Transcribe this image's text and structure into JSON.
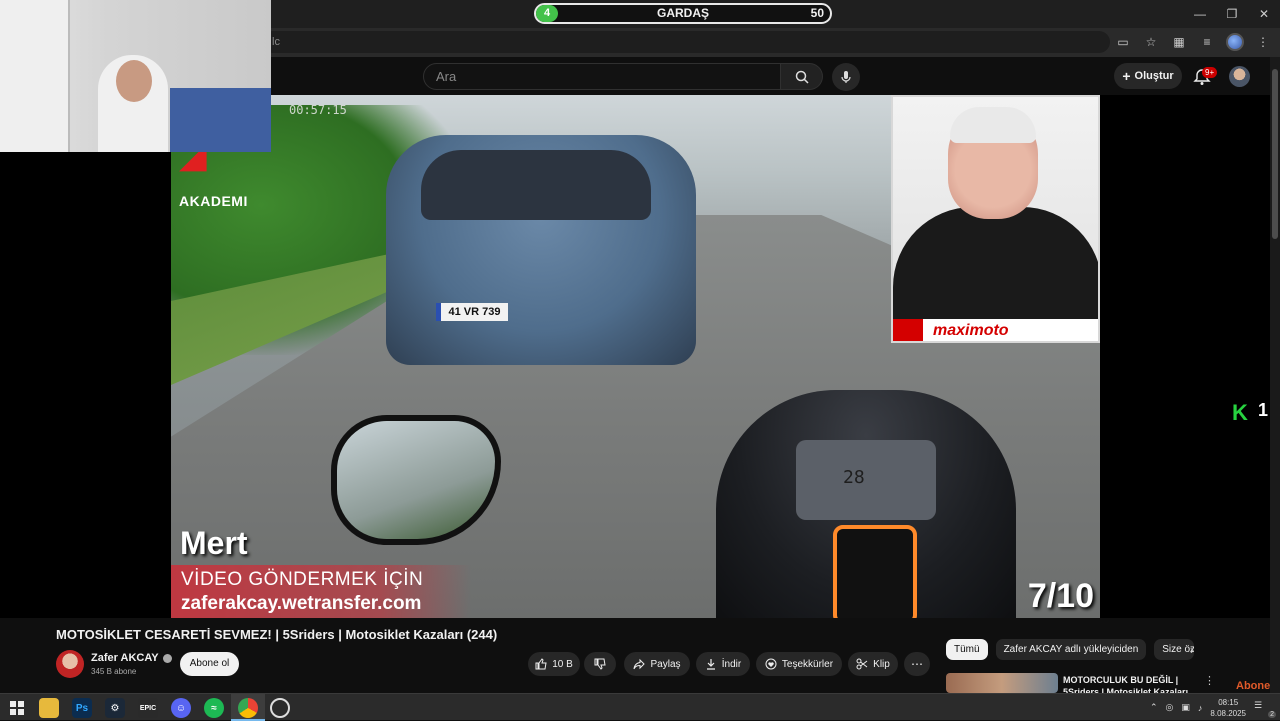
{
  "poll": {
    "left_value": "4",
    "title": "GARDAŞ",
    "right_value": "50"
  },
  "omnibox": {
    "text": "lc"
  },
  "youtube": {
    "search_placeholder": "Ara",
    "create_label": "Oluştur",
    "notifications_badge": "9+"
  },
  "video": {
    "timestamp": "00:57:15",
    "brand_text": "AKADEMI",
    "plate": "41 VR 739",
    "speed": "28",
    "sender_name": "Mert",
    "send_line1": "VİDEO GÖNDERMEK İÇİN",
    "send_line2": "zaferakcay.wetransfer.com",
    "counter": "7/10",
    "pip_brand": "maximoto"
  },
  "overlay": {
    "k_number": "1",
    "abone": "Abone ol"
  },
  "meta": {
    "title": "MOTOSİKLET CESARETİ SEVMEZ! | 5Sriders | Motosiklet Kazaları (244)",
    "channel_name": "Zafer AKCAY",
    "subscribers": "345 B abone",
    "subscribe_label": "Abone ol",
    "like_count": "10 B",
    "share_label": "Paylaş",
    "download_label": "İndir",
    "thanks_label": "Teşekkürler",
    "clip_label": "Klip"
  },
  "chips": [
    "Tümü",
    "Zafer AKCAY adlı yükleyiciden",
    "Size özel"
  ],
  "recommendation": {
    "title": "MOTORCULUK BU DEĞİL | 5Sriders | Motosiklet Kazaları"
  },
  "taskbar": {
    "time": "08:15",
    "date": "8.08.2025",
    "notification_count": "2",
    "apps": [
      "start",
      "explorer",
      "photoshop",
      "steam",
      "epic",
      "discord",
      "spotify",
      "chrome",
      "obs"
    ]
  },
  "colors": {
    "accent_green": "#43c24a",
    "brand_red": "#d40000",
    "kick_green": "#27d240"
  }
}
